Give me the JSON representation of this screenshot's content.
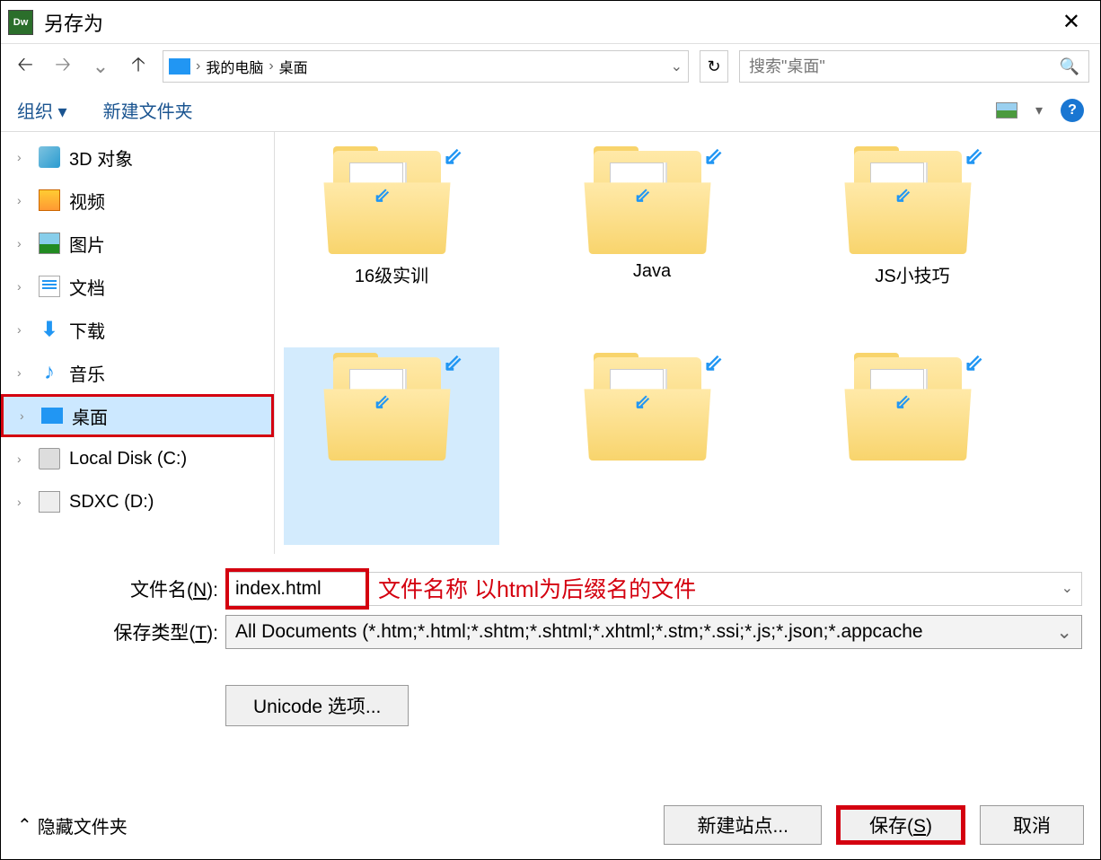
{
  "title": "另存为",
  "breadcrumb": {
    "root": "我的电脑",
    "current": "桌面"
  },
  "search": {
    "placeholder": "搜索\"桌面\""
  },
  "toolbar": {
    "organize": "组织",
    "newFolder": "新建文件夹"
  },
  "sidebar": [
    {
      "label": "3D 对象",
      "iconClass": "icon-3d"
    },
    {
      "label": "视频",
      "iconClass": "icon-video"
    },
    {
      "label": "图片",
      "iconClass": "icon-picture"
    },
    {
      "label": "文档",
      "iconClass": "icon-doc"
    },
    {
      "label": "下载",
      "iconClass": "icon-download",
      "glyph": "⬇"
    },
    {
      "label": "音乐",
      "iconClass": "icon-music",
      "glyph": "♪"
    },
    {
      "label": "桌面",
      "iconClass": "icon-desktop",
      "selected": true
    },
    {
      "label": "Local Disk (C:)",
      "iconClass": "icon-disk"
    },
    {
      "label": "SDXC (D:)",
      "iconClass": "icon-sd"
    }
  ],
  "files": [
    {
      "label": "16级实训"
    },
    {
      "label": "Java"
    },
    {
      "label": "JS小技巧"
    },
    {
      "label": "",
      "selected": true
    },
    {
      "label": ""
    },
    {
      "label": ""
    }
  ],
  "form": {
    "filenameLabel": "文件名(N):",
    "filenameValue": "index.html",
    "annotation": "文件名称 以html为后缀名的文件",
    "filetypeLabel": "保存类型(T):",
    "filetypeValue": "All Documents (*.htm;*.html;*.shtm;*.shtml;*.xhtml;*.stm;*.ssi;*.js;*.json;*.appcache",
    "unicodeBtn": "Unicode 选项..."
  },
  "footer": {
    "hide": "隐藏文件夹",
    "newSite": "新建站点...",
    "save": "保存(S)",
    "cancel": "取消"
  }
}
